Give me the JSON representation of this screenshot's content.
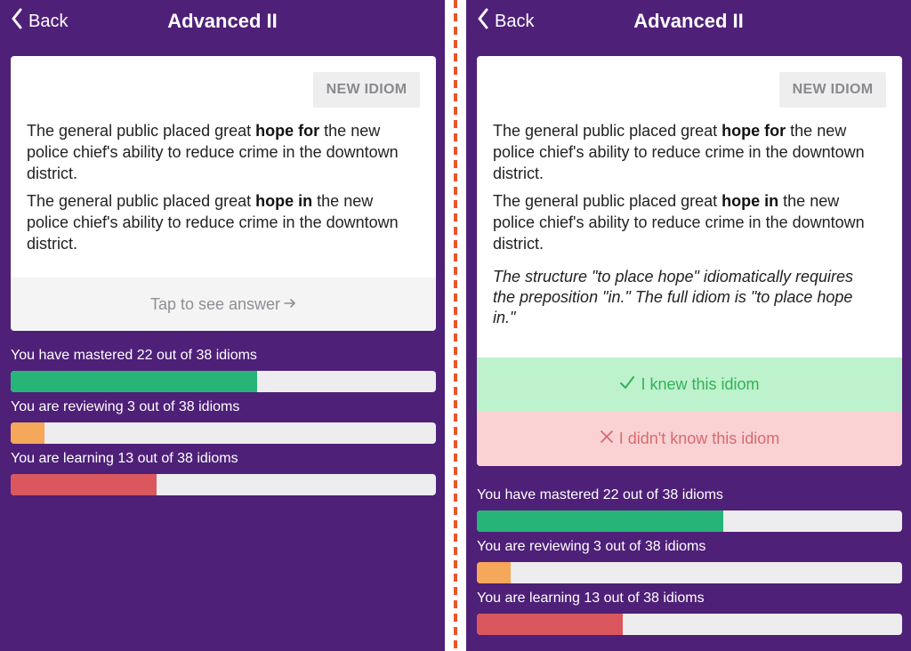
{
  "colors": {
    "background": "#4e2078",
    "mastered": "#27b478",
    "reviewing": "#f5a75a",
    "learning": "#d9575d",
    "divider": "#e8562a"
  },
  "header": {
    "back_label": "Back",
    "title": "Advanced II"
  },
  "card": {
    "new_idiom_label": "NEW IDIOM",
    "sentence_1": {
      "before": "The general public placed great ",
      "bold": "hope for",
      "after": " the new police chief's ability to reduce crime in the downtown district."
    },
    "sentence_2": {
      "before": "The general public placed great ",
      "bold": "hope in",
      "after": " the new police chief's ability to reduce crime in the downtown district."
    },
    "tap_answer_label": "Tap to see answer",
    "explanation": "The structure \"to place hope\" idiomatically requires the preposition \"in.\" The full idiom is \"to place hope in.\"",
    "knew_label": "I knew this idiom",
    "didnt_know_label": "I didn't know this idiom"
  },
  "progress": {
    "total": 38,
    "mastered": {
      "label": "You have mastered 22 out of 38 idioms",
      "count": 22
    },
    "reviewing": {
      "label": "You are reviewing 3 out of 38 idioms",
      "count": 3
    },
    "learning": {
      "label": "You are learning 13 out of 38 idioms",
      "count": 13
    }
  }
}
